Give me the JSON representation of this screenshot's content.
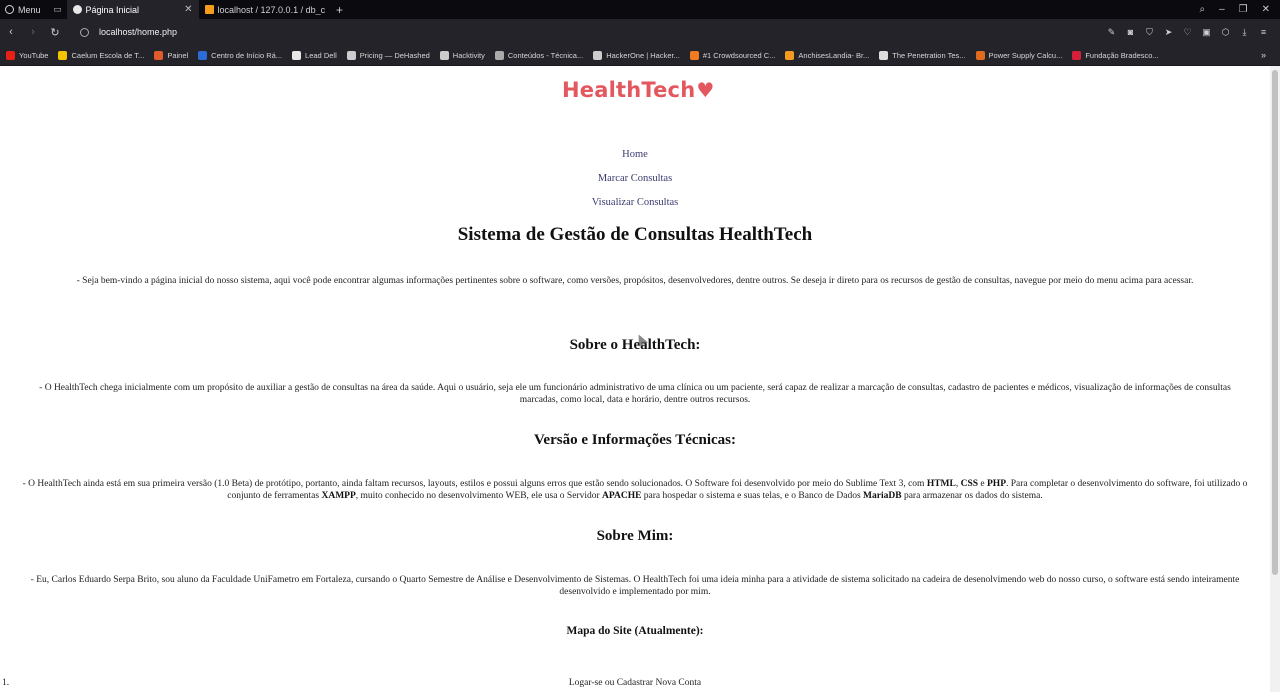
{
  "browser": {
    "menu_label": "Menu",
    "tabs": [
      {
        "title": "Página Inicial"
      },
      {
        "title": "localhost / 127.0.0.1 / db_c"
      }
    ],
    "url": "localhost/home.php",
    "bookmarks": [
      {
        "label": "YouTube",
        "color": "#e62117"
      },
      {
        "label": "Caelum Escola de T...",
        "color": "#f5c400"
      },
      {
        "label": "Painel",
        "color": "#e05a2b"
      },
      {
        "label": "Centro de Início Rá...",
        "color": "#2d6cd6"
      },
      {
        "label": "Lead Dell",
        "color": "#e8e8e8"
      },
      {
        "label": "Pricing — DeHashed",
        "color": "#cccccc"
      },
      {
        "label": "Hacktivity",
        "color": "#cccccc"
      },
      {
        "label": "Conteúdos - Técnica...",
        "color": "#aaaaaa"
      },
      {
        "label": "HackerOne | Hacker...",
        "color": "#cccccc"
      },
      {
        "label": "#1 Crowdsourced C...",
        "color": "#f07c22"
      },
      {
        "label": "AnchisesLandia- Br...",
        "color": "#f29b20"
      },
      {
        "label": "The Penetration Tes...",
        "color": "#dddddd"
      },
      {
        "label": "Power Supply Calcu...",
        "color": "#e06a1e"
      },
      {
        "label": "Fundação Bradesco...",
        "color": "#d6203a"
      }
    ]
  },
  "site": {
    "logo_text": "HealthTech",
    "brand_color": "#e3585f",
    "nav": [
      {
        "label": "Home"
      },
      {
        "label": "Marcar Consultas"
      },
      {
        "label": "Visualizar Consultas"
      }
    ],
    "title": "Sistema de Gestão de Consultas HealthTech",
    "intro": "- Seja bem-vindo a página inicial do nosso sistema, aqui você pode encontrar algumas informações pertinentes sobre o software, como versões, propósitos, desenvolvedores, dentre outros. Se deseja ir direto para os recursos de gestão de consultas, navegue por meio do menu acima para acessar.",
    "about": {
      "heading": "Sobre o HealthTech:",
      "text": "- O HealthTech chega inicialmente com um propósito de auxiliar a gestão de consultas na área da saúde. Aqui o usuário, seja ele um funcionário administrativo de uma clínica ou um paciente, será capaz de realizar a marcação de consultas, cadastro de pacientes e médicos, visualização de informações de consultas marcadas, como local, data e horário, dentre outros recursos."
    },
    "version": {
      "heading": "Versão e Informações Técnicas:",
      "t1": "- O HealthTech ainda está em sua primeira versão (1.0 Beta) de protótipo, portanto, ainda faltam recursos, layouts, estilos e possui alguns erros que estão sendo solucionados. O Software foi desenvolvido por meio do Sublime Text 3, com ",
      "b1": "HTML",
      "t2": ", ",
      "b2": "CSS",
      "t3": " e ",
      "b3": "PHP",
      "t4": ". Para completar o desenvolvimento do software, foi utilizado o conjunto de ferramentas ",
      "b4": "XAMPP",
      "t5": ", muito conhecido no desenvolvimento WEB, ele usa o Servidor ",
      "b5": "APACHE",
      "t6": " para hospedar o sistema e suas telas, e o Banco de Dados ",
      "b6": "MariaDB",
      "t7": " para armazenar os dados do sistema."
    },
    "me": {
      "heading": "Sobre Mim:",
      "text": "- Eu, Carlos Eduardo Serpa Brito, sou aluno da Faculdade UniFametro em Fortaleza, cursando o Quarto Semestre de Análise e Desenvolvimento de Sistemas. O HealthTech foi uma ideia minha para a atividade de sistema solicitado na cadeira de desenolvimendo web do nosso curso, o software está sendo inteiramente desenvolvido e implementado por mim."
    },
    "sitemap": {
      "heading": "Mapa do Site (Atualmente):",
      "item_number": "1.",
      "item": "Logar-se ou Cadastrar Nova Conta"
    }
  }
}
